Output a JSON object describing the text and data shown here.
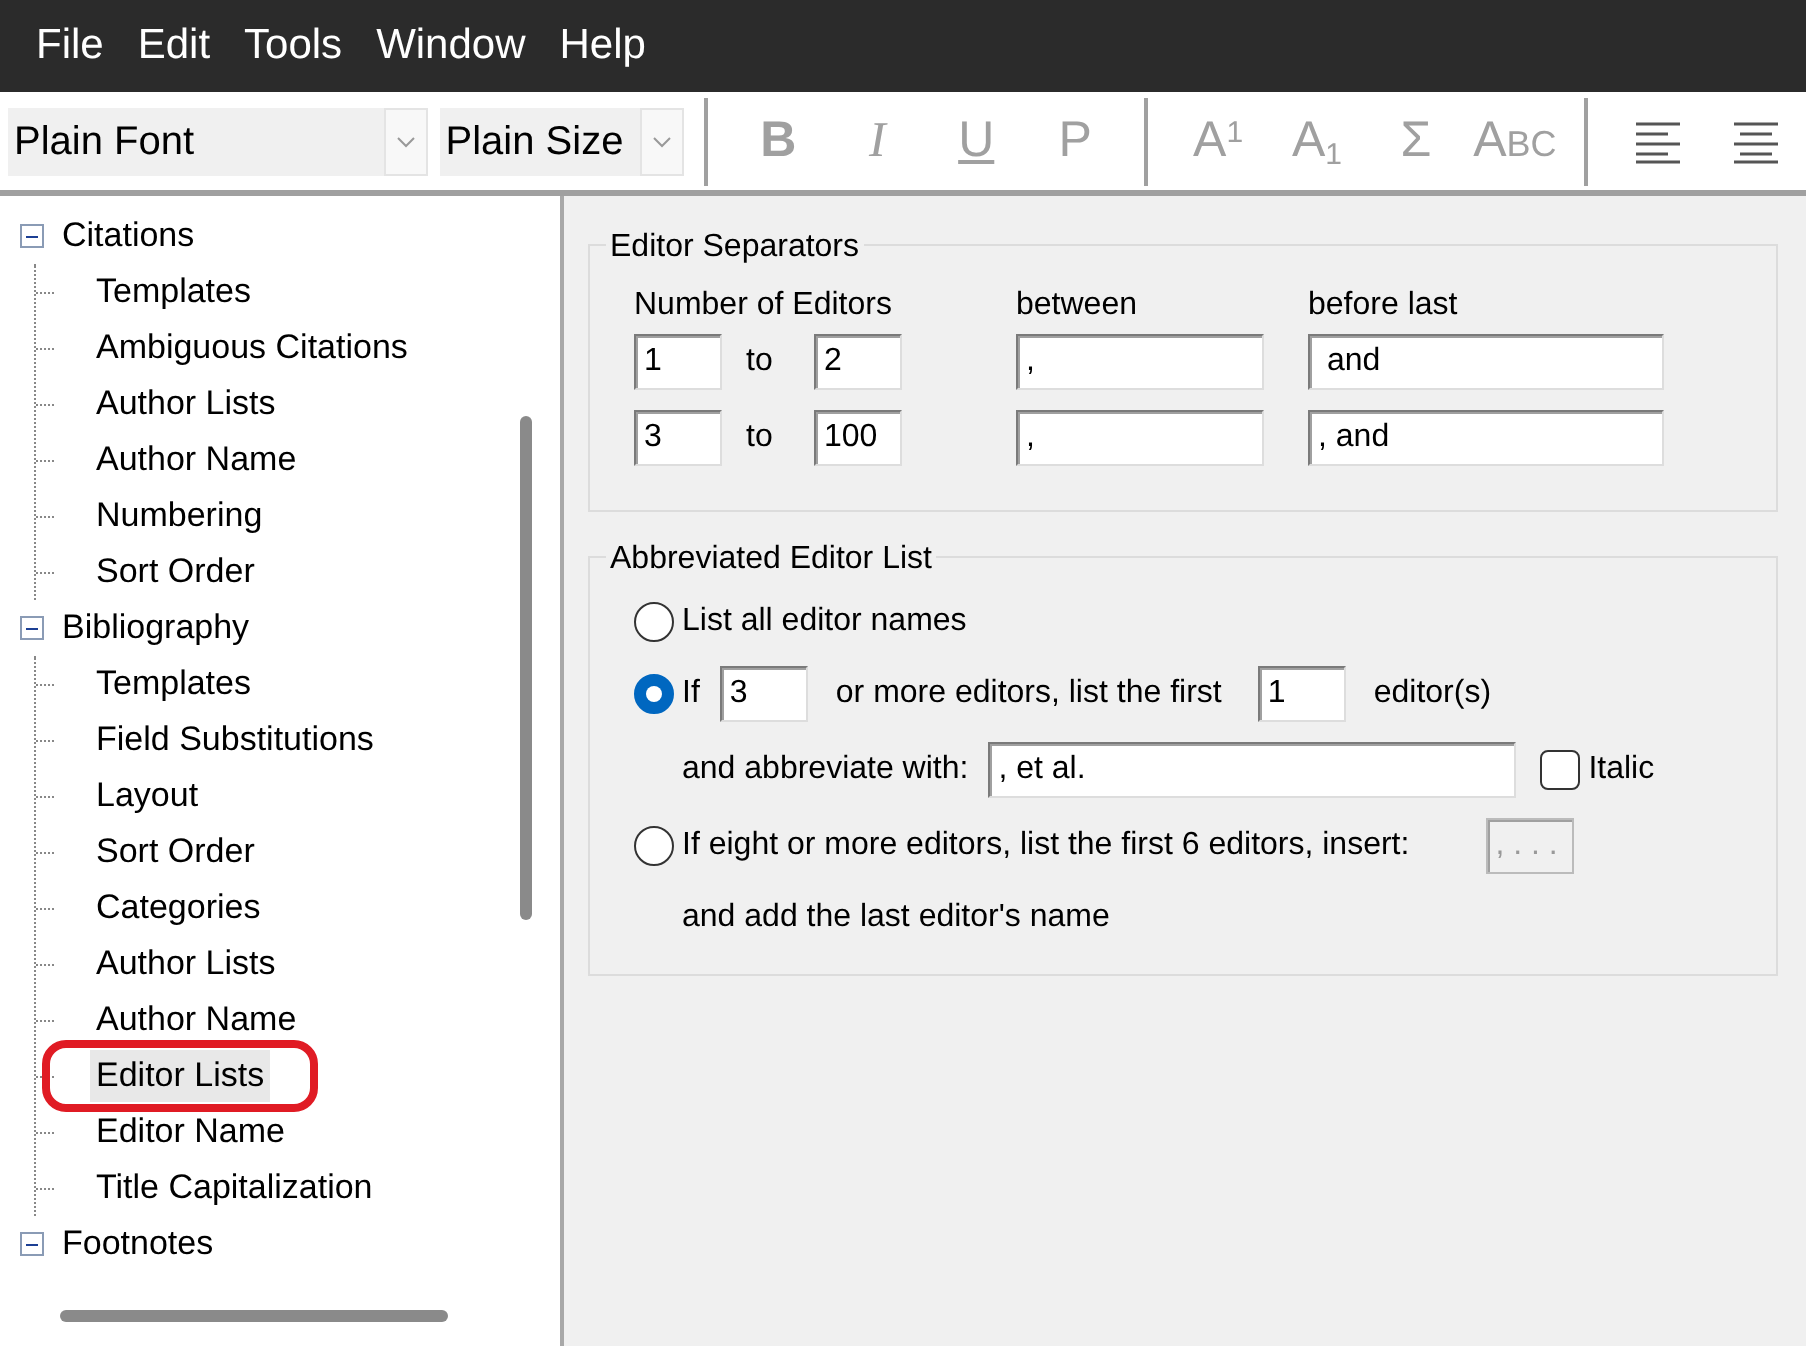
{
  "menu": [
    {
      "label": "File"
    },
    {
      "label": "Edit"
    },
    {
      "label": "Tools"
    },
    {
      "label": "Window"
    },
    {
      "label": "Help"
    }
  ],
  "toolbar": {
    "font_select": "Plain Font",
    "size_select": "Plain Size",
    "buttons": [
      {
        "kind": "bold",
        "label": "B",
        "disabled": true
      },
      {
        "kind": "italic",
        "label": "I",
        "disabled": true
      },
      {
        "kind": "underline",
        "label": "U",
        "disabled": true
      },
      {
        "kind": "plain",
        "label": "P",
        "disabled": true
      },
      {
        "kind": "sep"
      },
      {
        "kind": "plain",
        "label": "A$^{1}$",
        "disabled": true
      },
      {
        "kind": "plain",
        "label": "A$_{1}$",
        "disabled": true
      },
      {
        "kind": "plain",
        "label": "Σ",
        "disabled": true
      },
      {
        "kind": "smallcaps",
        "label": "Abc",
        "disabled": true
      },
      {
        "kind": "sep"
      },
      {
        "kind": "align-left",
        "disabled": false
      },
      {
        "kind": "align-center",
        "disabled": false
      }
    ]
  },
  "tree": [
    {
      "label": "Citations",
      "expanded": true,
      "selected": false,
      "children": [
        {
          "label": "Templates",
          "selected": false,
          "circled": false
        },
        {
          "label": "Ambiguous Citations",
          "selected": false,
          "circled": false
        },
        {
          "label": "Author Lists",
          "selected": false,
          "circled": false
        },
        {
          "label": "Author Name",
          "selected": false,
          "circled": false
        },
        {
          "label": "Numbering",
          "selected": false,
          "circled": false
        },
        {
          "label": "Sort Order",
          "selected": false,
          "circled": false
        }
      ]
    },
    {
      "label": "Bibliography",
      "expanded": true,
      "selected": false,
      "children": [
        {
          "label": "Templates",
          "selected": false,
          "circled": false
        },
        {
          "label": "Field Substitutions",
          "selected": false,
          "circled": false
        },
        {
          "label": "Layout",
          "selected": false,
          "circled": false
        },
        {
          "label": "Sort Order",
          "selected": false,
          "circled": false
        },
        {
          "label": "Categories",
          "selected": false,
          "circled": false
        },
        {
          "label": "Author Lists",
          "selected": false,
          "circled": false
        },
        {
          "label": "Author Name",
          "selected": false,
          "circled": false
        },
        {
          "label": "Editor Lists",
          "selected": true,
          "circled": true
        },
        {
          "label": "Editor Name",
          "selected": false,
          "circled": false
        },
        {
          "label": "Title Capitalization",
          "selected": false,
          "circled": false
        }
      ]
    },
    {
      "label": "Footnotes",
      "expanded": true,
      "selected": false
    }
  ],
  "separators": {
    "title": "Editor Separators",
    "headers": [
      "Number of Editors",
      "between",
      "before last"
    ],
    "rows": [
      {
        "from": "1",
        "to_label": "to",
        "to": "2",
        "between": ",",
        "before_last": " and"
      },
      {
        "from": "3",
        "to_label": "to",
        "to": "100",
        "between": ",",
        "before_last": ", and"
      }
    ]
  },
  "abbreviated": {
    "title": "Abbreviated Editor List",
    "options": [
      {
        "kind": "plain",
        "label": "List all editor names",
        "selected": false
      },
      {
        "kind": "first",
        "label": "If",
        "selected": true,
        "count": "3",
        "middle": "or more editors, list the first",
        "first": "1",
        "suffix": "editor(s)",
        "abbr_label": "and abbreviate with:",
        "abbr_value": ", et al.",
        "italic_label": "Italic",
        "italic": false
      },
      {
        "kind": "insert",
        "label": "If eight or more editors, list the first 6 editors, insert:",
        "selected": false,
        "insert_value": ", . . .",
        "insert_disabled": true,
        "after": "and add the last editor's name"
      }
    ]
  }
}
